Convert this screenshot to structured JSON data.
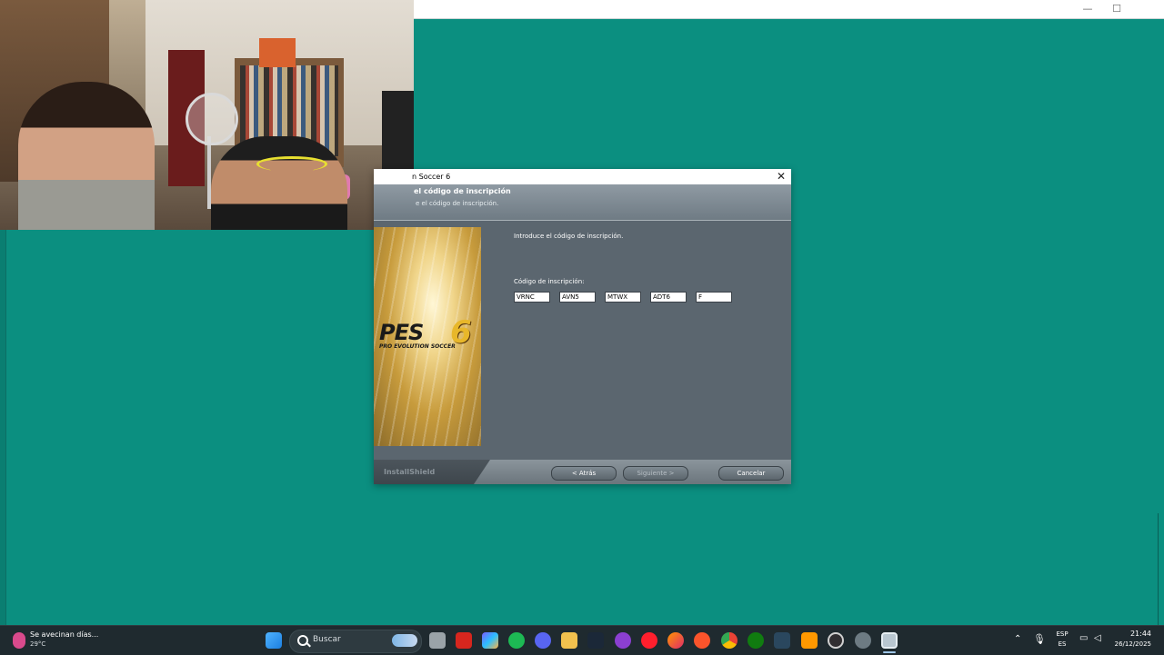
{
  "window": {
    "minimize_symbol": "—",
    "maximize_symbol": "☐"
  },
  "dialog": {
    "title": "n Soccer 6",
    "close_symbol": "✕",
    "header_title": "el código de inscripción",
    "header_subtitle": "e el código de inscripción.",
    "banner_logo": {
      "main": "PES",
      "number": "6",
      "sub": "PRO EVOLUTION SOCCER"
    },
    "prompt": "Introduce el código de inscripción.",
    "code_label": "Código de inscripción:",
    "code_fields": [
      "VRNC",
      "AVN5",
      "MTWX",
      "ADT6",
      "F"
    ],
    "brand": "InstallShield",
    "buttons": {
      "back": "< Atrás",
      "next": "Siguiente >",
      "cancel": "Cancelar"
    }
  },
  "taskbar": {
    "weather": {
      "title": "Se avecinan días...",
      "temp": "29°C"
    },
    "search_placeholder": "Buscar",
    "apps": [
      "windows-start",
      "file-manager",
      "acrobat",
      "copilot",
      "spotify",
      "discord",
      "file-explorer",
      "steam",
      "game-app",
      "youtube-music",
      "firefox",
      "brave",
      "chrome",
      "xbox",
      "steam-alt",
      "sublime",
      "obs",
      "settings",
      "installer"
    ],
    "tray": {
      "language_top": "ESP",
      "language_bottom": "ES",
      "time": "21:44",
      "date": "26/12/2025"
    }
  },
  "colors": {
    "desktop": "#0b8f80",
    "dialog_bg": "#5b666f",
    "taskbar": "#1f2a2f"
  }
}
